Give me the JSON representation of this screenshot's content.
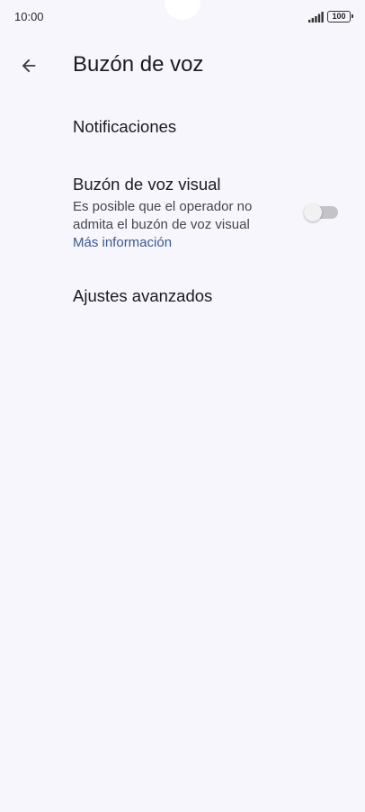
{
  "status_bar": {
    "time": "10:00",
    "battery": "100"
  },
  "header": {
    "title": "Buzón de voz"
  },
  "settings": {
    "notifications": {
      "title": "Notificaciones"
    },
    "visual_voicemail": {
      "title": "Buzón de voz visual",
      "description_line1": "Es posible que el operador no",
      "description_line2": "admita el buzón de voz visual",
      "link": "Más información",
      "enabled": false
    },
    "advanced": {
      "title": "Ajustes avanzados"
    }
  },
  "colors": {
    "background": "#f7f6fc",
    "link": "#3a5a8e",
    "toggle_off": "#c4c4c8"
  }
}
